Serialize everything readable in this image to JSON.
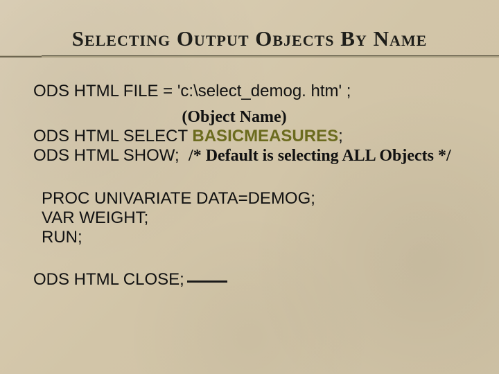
{
  "title": "Selecting Output Objects By Name",
  "code": {
    "line1": "ODS HTML FILE = 'c:\\select_demog. htm' ;",
    "object_note": "(Object Name)",
    "select_prefix": "ODS HTML SELECT ",
    "select_object": "BASICMEASURES",
    "select_suffix": ";",
    "show_prefix": "ODS HTML SHOW;",
    "show_comment": "/* Default is selecting ALL Objects */",
    "proc1": "PROC UNIVARIATE DATA=DEMOG;",
    "proc2": "VAR WEIGHT;",
    "proc3": "RUN;",
    "close": "ODS HTML CLOSE;"
  }
}
